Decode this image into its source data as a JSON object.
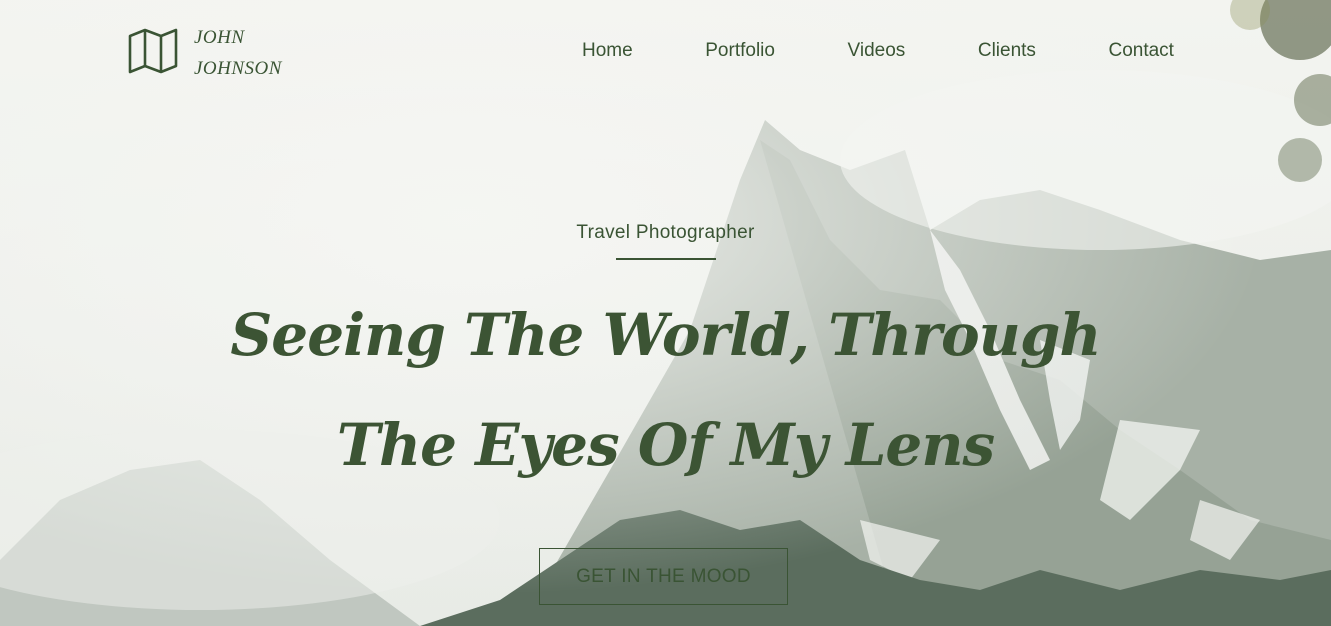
{
  "brand": {
    "first": "JOHN",
    "last": "JOHNSON",
    "icon": "map-icon"
  },
  "nav": {
    "items": [
      "Home",
      "Portfolio",
      "Videos",
      "Clients",
      "Contact"
    ]
  },
  "hero": {
    "subtitle": "Travel Photographer",
    "headline_line1": "Seeing The World, Through",
    "headline_line2": "The Eyes Of My Lens",
    "cta_label": "GET IN THE MOOD"
  },
  "colors": {
    "accent": "#3a5434",
    "sky": "#f1f2ee",
    "rock": "#9aa69c",
    "forest": "#5a6e5c"
  }
}
